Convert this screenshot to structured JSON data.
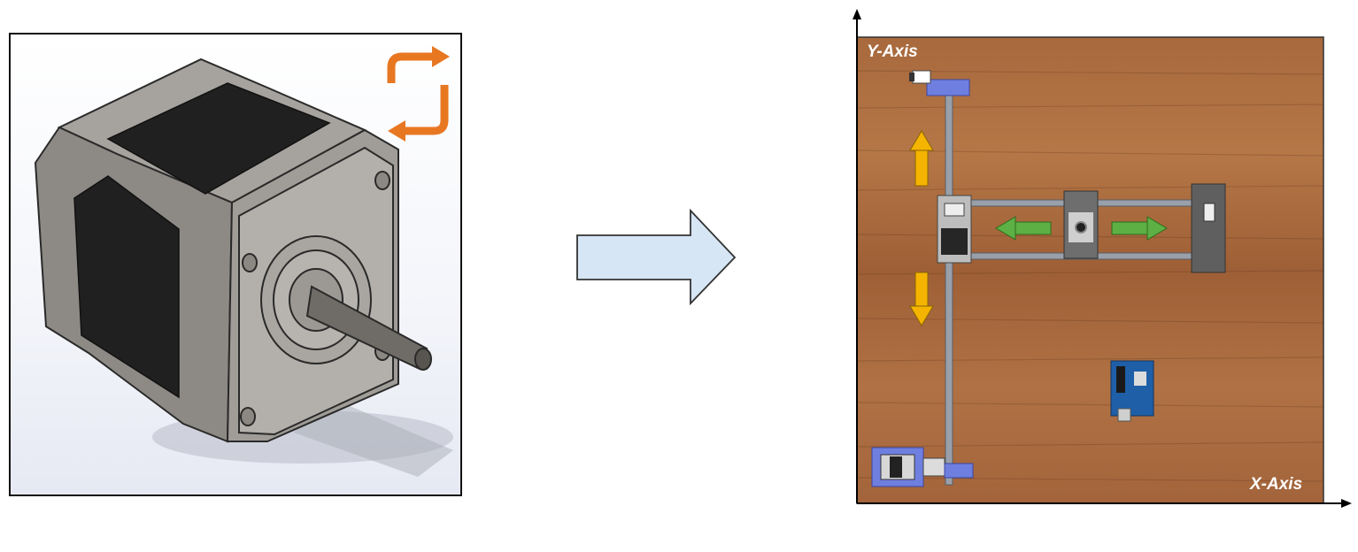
{
  "left_panel": {
    "subject": "stepper-motor",
    "rotation_icon": "rotate-cycle-icon",
    "rotation_icon_color": "#E87722"
  },
  "transition_arrow": {
    "icon": "right-arrow-icon",
    "fill": "#D6E6F5",
    "stroke": "#333333"
  },
  "right_panel": {
    "y_axis_label": "Y-Axis",
    "x_axis_label": "X-Axis",
    "surface": "wood",
    "y_motion_color": "#F5B400",
    "x_motion_color": "#5DB044",
    "bracket_color": "#6F7FE0"
  }
}
